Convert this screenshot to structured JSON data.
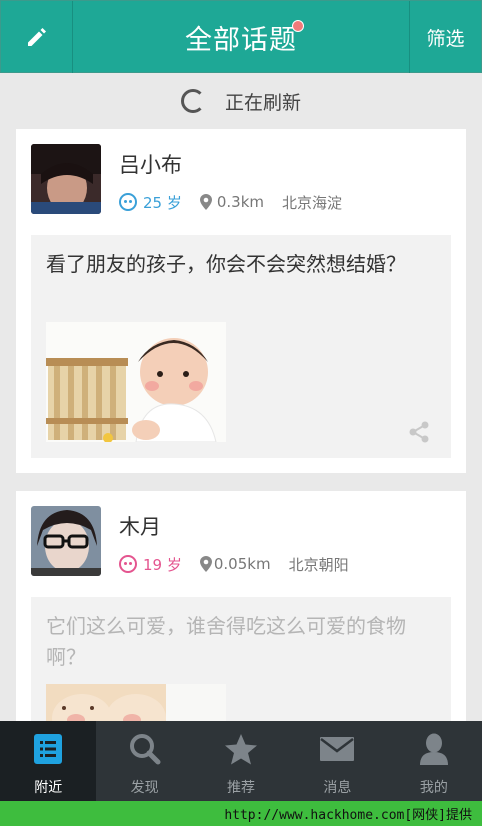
{
  "header": {
    "title": "全部话题",
    "filter_label": "筛选",
    "edit_icon": "pencil-icon",
    "notification_dot_color": "#f07a7a",
    "accent_color": "#1ea896"
  },
  "refresh": {
    "label": "正在刷新"
  },
  "posts": [
    {
      "user_name": "吕小布",
      "gender": "male",
      "age": "25 岁",
      "distance": "0.3km",
      "location": "北京海淀",
      "text": "看了朋友的孩子，你会不会突然想结婚？",
      "has_photo": true
    },
    {
      "user_name": "木月",
      "gender": "female",
      "age": "19 岁",
      "distance": "0.05km",
      "location": "北京朝阳",
      "text": "它们这么可爱，谁舍得吃这么可爱的食物啊？",
      "has_photo": true
    }
  ],
  "tabs": [
    {
      "label": "附近",
      "icon": "list-icon",
      "active": true
    },
    {
      "label": "发现",
      "icon": "search-icon",
      "active": false
    },
    {
      "label": "推荐",
      "icon": "star-icon",
      "active": false
    },
    {
      "label": "消息",
      "icon": "mail-icon",
      "active": false
    },
    {
      "label": "我的",
      "icon": "person-icon",
      "active": false
    }
  ],
  "watermark": "http://www.hackhome.com[网侠]提供"
}
